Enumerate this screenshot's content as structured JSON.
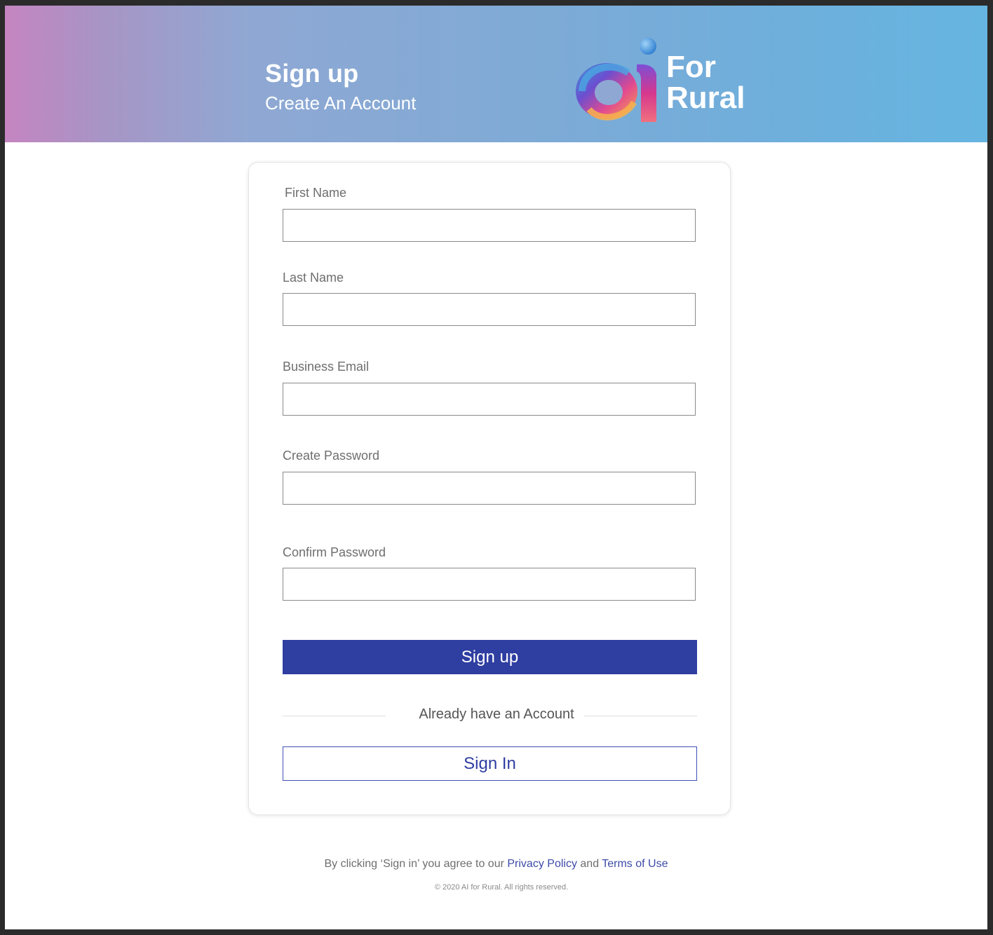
{
  "header": {
    "title": "Sign up",
    "subtitle": "Create An Account",
    "logo_text_line1": "For",
    "logo_text_line2": "Rural",
    "logo_mark": "ai"
  },
  "form": {
    "fields": [
      {
        "label": "First Name",
        "value": "",
        "placeholder": ""
      },
      {
        "label": "Last Name",
        "value": "",
        "placeholder": ""
      },
      {
        "label": "Business Email",
        "value": "",
        "placeholder": ""
      },
      {
        "label": "Create Password",
        "value": "",
        "placeholder": ""
      },
      {
        "label": "Confirm Password",
        "value": "",
        "placeholder": ""
      }
    ],
    "signup_label": "Sign up",
    "divider_text": "Already have an Account",
    "signin_label": "Sign In"
  },
  "footer": {
    "agree_prefix": "By clicking ‘Sign in’ you agree to our ",
    "privacy_link": "Privacy Policy",
    "and_text": " and ",
    "terms_link": "Terms of Use",
    "copyright": "© 2020 AI for Rural. All rights reserved."
  },
  "colors": {
    "primary": "#2f3ea1",
    "banner_start": "#c585c1",
    "banner_end": "#66b5e1",
    "link": "#3d4ba8"
  },
  "icons": {
    "logo": "ai-for-rural-logo-icon"
  }
}
